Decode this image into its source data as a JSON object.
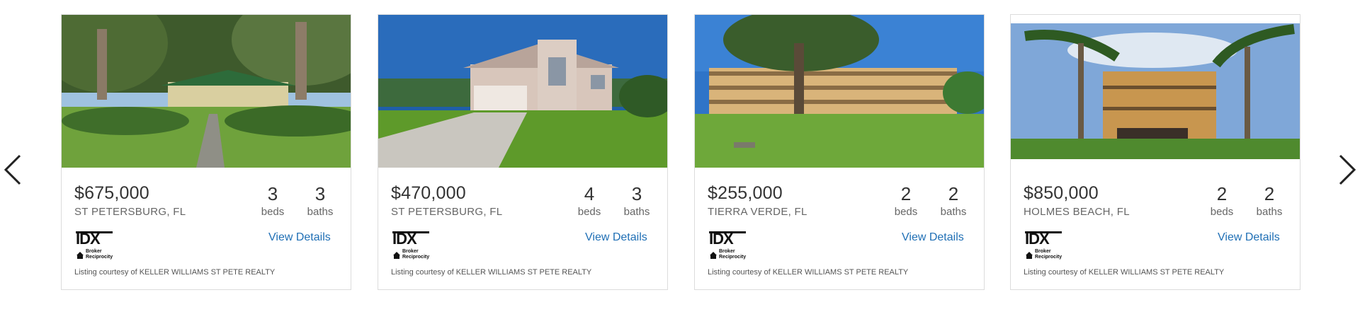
{
  "carousel": {
    "prev_icon": "chevron-left-icon",
    "next_icon": "chevron-right-icon",
    "listings": [
      {
        "photo": "house-photo-bungalow",
        "price": "$675,000",
        "location": "ST PETERSBURG, FL",
        "beds": "3",
        "beds_label": "beds",
        "baths": "3",
        "baths_label": "baths",
        "logo": "IDX Broker Reciprocity",
        "link": "View Details",
        "courtesy": "Listing courtesy of KELLER WILLIAMS ST PETE REALTY"
      },
      {
        "photo": "house-photo-two-story",
        "price": "$470,000",
        "location": "ST PETERSBURG, FL",
        "beds": "4",
        "beds_label": "beds",
        "baths": "3",
        "baths_label": "baths",
        "logo": "IDX Broker Reciprocity",
        "link": "View Details",
        "courtesy": "Listing courtesy of KELLER WILLIAMS ST PETE REALTY"
      },
      {
        "photo": "condo-photo-lawn",
        "price": "$255,000",
        "location": "TIERRA VERDE, FL",
        "beds": "2",
        "beds_label": "beds",
        "baths": "2",
        "baths_label": "baths",
        "logo": "IDX Broker Reciprocity",
        "link": "View Details",
        "courtesy": "Listing courtesy of KELLER WILLIAMS ST PETE REALTY"
      },
      {
        "photo": "condo-photo-palms",
        "price": "$850,000",
        "location": "HOLMES BEACH, FL",
        "beds": "2",
        "beds_label": "beds",
        "baths": "2",
        "baths_label": "baths",
        "logo": "IDX Broker Reciprocity",
        "link": "View Details",
        "courtesy": "Listing courtesy of KELLER WILLIAMS ST PETE REALTY"
      }
    ]
  },
  "colors": {
    "link": "#1f6fb5",
    "price_text": "#333333",
    "secondary_text": "#666666",
    "card_border": "#dcdcdc"
  }
}
